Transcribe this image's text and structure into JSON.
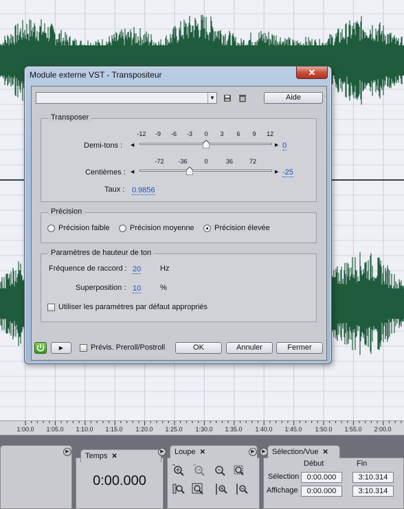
{
  "dialog": {
    "title": "Module externe VST - Transpositeur",
    "close_glyph": "✕",
    "toolbar": {
      "preset_value": "",
      "help_label": "Aide"
    },
    "transposer": {
      "title": "Transposer",
      "semitones_label": "Demi-tons :",
      "semitones_scale": [
        "-12",
        "-9",
        "-6",
        "-3",
        "0",
        "3",
        "6",
        "9",
        "12"
      ],
      "semitones_value": "0",
      "cents_label": "Centièmes :",
      "cents_scale": [
        "-72",
        "-36",
        "0",
        "36",
        "72"
      ],
      "cents_value": "-25",
      "ratio_label": "Taux :",
      "ratio_value": "0.9856"
    },
    "precision": {
      "title": "Précision",
      "options": [
        "Précision faible",
        "Précision moyenne",
        "Précision élevée"
      ],
      "selected": "Précision élevée"
    },
    "pitch": {
      "title": "Paramètres de hauteur de ton",
      "splice_label": "Fréquence de raccord :",
      "splice_value": "20",
      "splice_unit": "Hz",
      "overlap_label": "Superposition :",
      "overlap_value": "10",
      "overlap_unit": "%",
      "defaults_label": "Utiliser les paramètres par défaut appropriés",
      "defaults_checked": false
    },
    "footer": {
      "preview_label": "Prévis. Preroll/Postroll",
      "ok_label": "OK",
      "cancel_label": "Annuler",
      "close_label": "Fermer"
    }
  },
  "timeline": {
    "ticks": [
      "1:00.0",
      "1:05.0",
      "1:10.0",
      "1:15.0",
      "1:20.0",
      "1:25.0",
      "1:30.0",
      "1:35.0",
      "1:40.0",
      "1:45.0",
      "1:50.0",
      "1:55.0",
      "2:00.0"
    ]
  },
  "panels": {
    "time": {
      "tab_label": "Temps",
      "display": "0:00.000"
    },
    "zoom": {
      "tab_label": "Loupe"
    },
    "selection": {
      "tab_label": "Sélection/Vue",
      "col_start": "Début",
      "col_end": "Fin",
      "row_selection": "Sélection",
      "row_view": "Affichage",
      "selection_start": "0:00.000",
      "selection_end": "3:10.314",
      "view_start": "0:00.000",
      "view_end": "3:10.314"
    }
  },
  "colors": {
    "waveform": "#1f5c3c",
    "dialog_frame": "#a8bfdc",
    "power_green": "#3aa81e"
  },
  "icons": [
    "save-icon",
    "trash-icon",
    "power-icon",
    "play-icon",
    "zoom-in-icon",
    "zoom-out-icon",
    "zoom-selection-icon",
    "zoom-full-icon"
  ]
}
